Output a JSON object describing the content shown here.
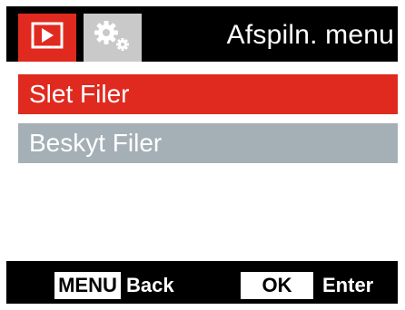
{
  "header": {
    "title": "Afspiln. menu",
    "tabs": [
      {
        "icon": "playback-icon",
        "active": true
      },
      {
        "icon": "settings-gears-icon",
        "active": false
      }
    ]
  },
  "menu": {
    "items": [
      {
        "label": "Slet Filer",
        "selected": true
      },
      {
        "label": "Beskyt Filer",
        "selected": false
      }
    ]
  },
  "footer": {
    "menu_key": "MENU",
    "menu_action": "Back",
    "ok_key": "OK",
    "ok_action": "Enter"
  },
  "colors": {
    "accent": "#e02a1f",
    "item_bg": "#a5b0b6",
    "inactive_tab": "#c9c9c9"
  }
}
